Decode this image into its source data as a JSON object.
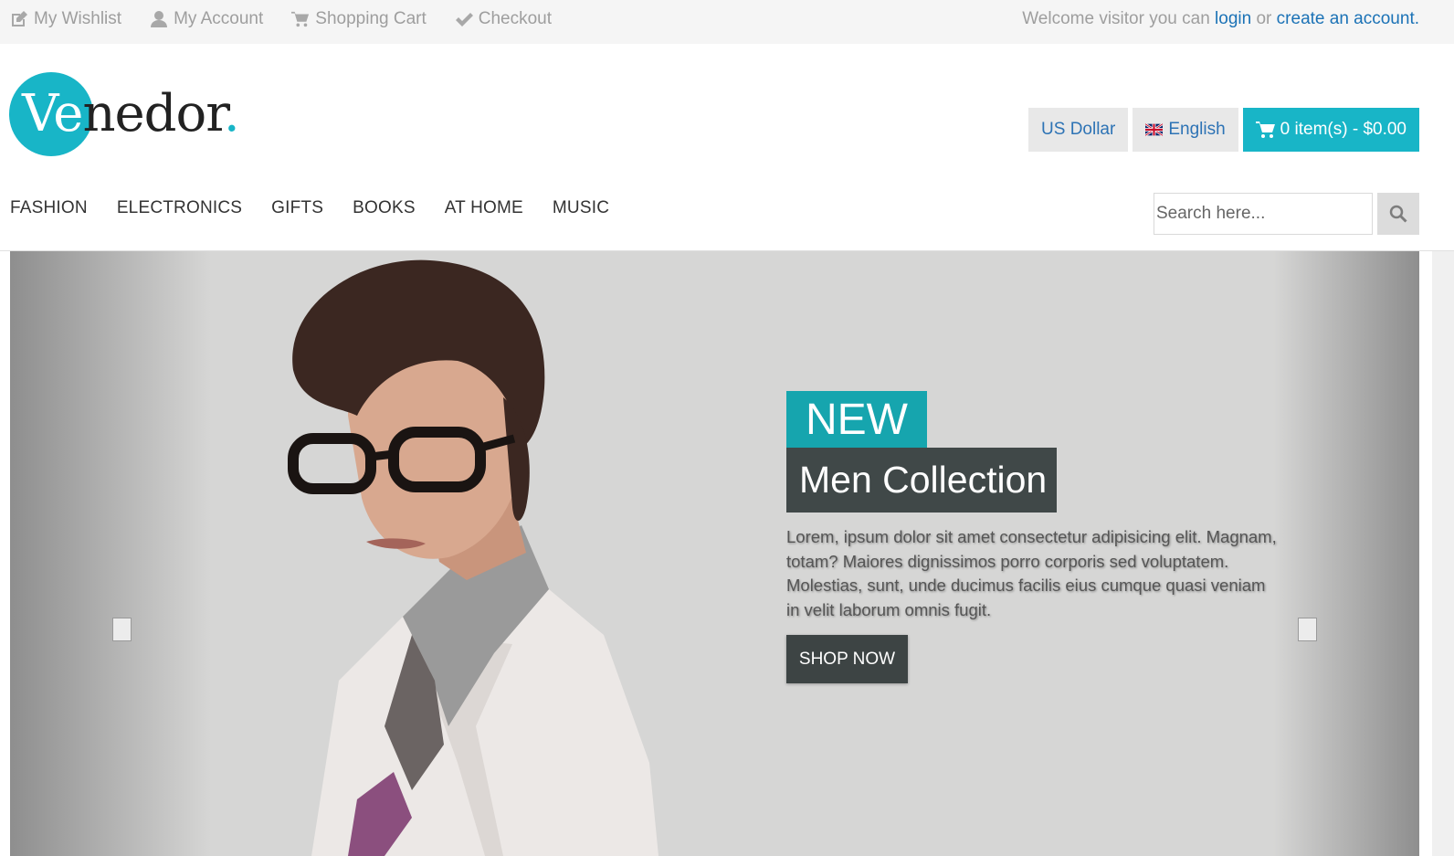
{
  "topbar": {
    "links": [
      {
        "label": "My Wishlist",
        "icon": "edit-icon"
      },
      {
        "label": "My Account",
        "icon": "user-icon"
      },
      {
        "label": "Shopping Cart",
        "icon": "cart-icon"
      },
      {
        "label": "Checkout",
        "icon": "check-icon"
      }
    ],
    "welcome_prefix": "Welcome visitor you can",
    "login_label": "login",
    "or_label": "or",
    "create_account_label": "create an account."
  },
  "header": {
    "logo_text_prefix": "Ve",
    "logo_text_rest": "nedor",
    "logo_dot": ".",
    "currency_label": "US Dollar",
    "language_label": "English",
    "cart_label": "0 item(s) - $0.00"
  },
  "nav": {
    "items": [
      "FASHION",
      "ELECTRONICS",
      "GIFTS",
      "BOOKS",
      "AT HOME",
      "MUSIC"
    ]
  },
  "search": {
    "placeholder": "Search here..."
  },
  "hero": {
    "badge": "NEW",
    "title": "Men Collection",
    "text": "Lorem, ipsum dolor sit amet consectetur adipisicing elit. Magnam, totam? Maiores dignissimos porro corporis sed voluptatem. Molestias, sunt, unde ducimus facilis eius cumque quasi veniam in velit laborum omnis fugit.",
    "button_label": "SHOP NOW"
  },
  "colors": {
    "accent": "#18b5c7",
    "dark": "#404848",
    "link": "#1b72b6"
  }
}
